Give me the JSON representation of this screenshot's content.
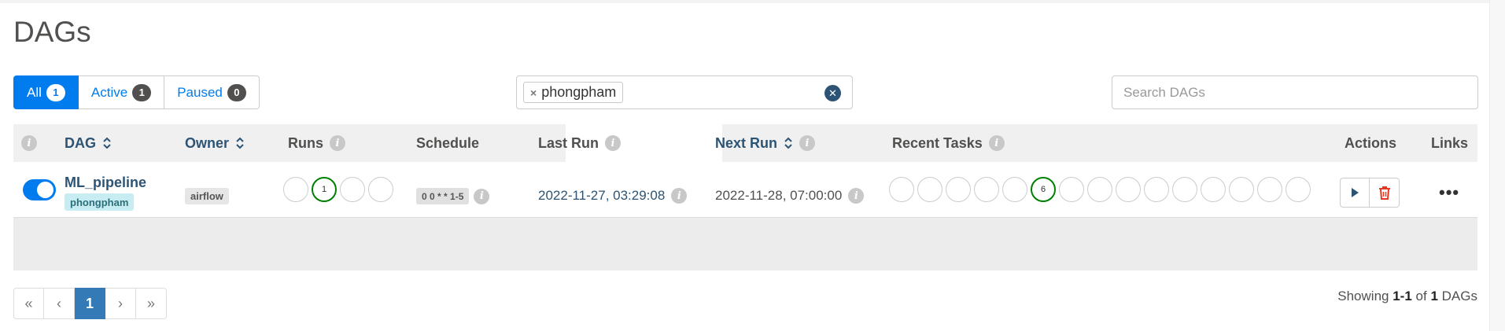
{
  "page": {
    "title": "DAGs"
  },
  "filters": [
    {
      "label": "All",
      "count": "1",
      "active": true
    },
    {
      "label": "Active",
      "count": "1",
      "active": false
    },
    {
      "label": "Paused",
      "count": "0",
      "active": false
    }
  ],
  "tag_filter": {
    "tag": "phongpham",
    "remove_glyph": "×",
    "clear_glyph": "✕"
  },
  "search": {
    "placeholder": "Search DAGs"
  },
  "table": {
    "headers": {
      "dag": "DAG",
      "owner": "Owner",
      "runs": "Runs",
      "schedule": "Schedule",
      "last_run": "Last Run",
      "next_run": "Next Run",
      "recent_tasks": "Recent Tasks",
      "actions": "Actions",
      "links": "Links"
    },
    "info_glyph": "i",
    "rows": [
      {
        "enabled": true,
        "dag_id": "ML_pipeline",
        "tag": "phongpham",
        "owner": "airflow",
        "runs": [
          "",
          "1",
          "",
          ""
        ],
        "runs_success_index": 1,
        "schedule": "0 0 * * 1-5",
        "last_run": "2022-11-27, 03:29:08",
        "next_run": "2022-11-28, 07:00:00",
        "recent_tasks": [
          "",
          "",
          "",
          "",
          "",
          "6",
          "",
          "",
          "",
          "",
          "",
          "",
          "",
          "",
          ""
        ],
        "recent_tasks_success_index": 5,
        "links_glyph": "•••"
      }
    ]
  },
  "pagination": {
    "first": "«",
    "prev": "‹",
    "current": "1",
    "next": "›",
    "last": "»"
  },
  "showing": {
    "prefix": "Showing",
    "range": "1-1",
    "of": "of",
    "total": "1",
    "suffix": "DAGs"
  },
  "colors": {
    "primary": "#017cee",
    "link": "#2d5474",
    "success": "#008000",
    "delete": "#e43921"
  }
}
